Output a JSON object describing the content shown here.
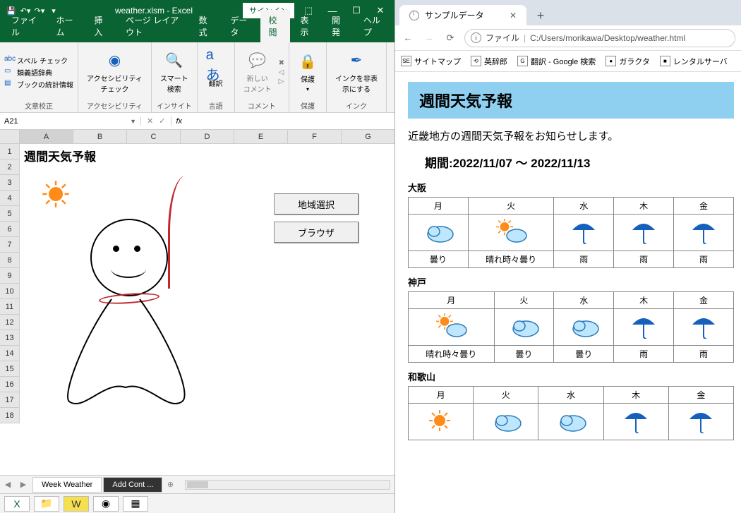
{
  "excel": {
    "filename": "weather.xlsm - Excel",
    "signin": "サインイン",
    "tabs": [
      "ファイル",
      "ホーム",
      "挿入",
      "ページ レイアウト",
      "数式",
      "データ",
      "校閲",
      "表示",
      "開発",
      "ヘルプ"
    ],
    "active_tab": "校閲",
    "ribbon": {
      "proofing": {
        "title": "文章校正",
        "spell": "スペル チェック",
        "thes": "類義語辞典",
        "stats": "ブックの統計情報"
      },
      "acc": {
        "title": "アクセシビリティ",
        "btn": "アクセシビリティ\nチェック"
      },
      "insights": {
        "title": "インサイト",
        "btn": "スマート\n検索"
      },
      "lang": {
        "title": "言語",
        "btn": "翻訳"
      },
      "comments": {
        "title": "コメント",
        "btn": "新しい\nコメント"
      },
      "protect": {
        "title": "保護",
        "btn": "保護"
      },
      "ink": {
        "title": "インク",
        "btn": "インクを非表\n示にする"
      }
    },
    "namebox": "A21",
    "cols": [
      "A",
      "B",
      "C",
      "D",
      "E",
      "F",
      "G"
    ],
    "rows": [
      "1",
      "2",
      "3",
      "4",
      "5",
      "6",
      "7",
      "8",
      "9",
      "10",
      "11",
      "12",
      "13",
      "14",
      "15",
      "16",
      "17",
      "18"
    ],
    "sheet_title": "週間天気予報",
    "btn_region": "地域選択",
    "btn_browser": "ブラウザ",
    "sheet_tabs": {
      "a": "Week Weather",
      "b": "Add Cont ..."
    }
  },
  "browser": {
    "tab_title": "サンプルデータ",
    "file_label": "ファイル",
    "url": "C:/Users/morikawa/Desktop/weather.html",
    "bookmarks": [
      {
        "ico": "SE",
        "label": "サイトマップ"
      },
      {
        "ico": "⟲",
        "label": "英辞郎"
      },
      {
        "ico": "G",
        "label": "翻訳 - Google 検索"
      },
      {
        "ico": "●",
        "label": "ガラクタ"
      },
      {
        "ico": "■",
        "label": "レンタルサーバ"
      }
    ],
    "page_title": "週間天気予報",
    "desc": "近畿地方の週間天気予報をお知らせします。",
    "period": "期間:2022/11/07 ～ 2022/11/13",
    "days": [
      "月",
      "火",
      "水",
      "木",
      "金"
    ],
    "cities": [
      {
        "name": "大阪",
        "icons": [
          "cloud",
          "suncloud",
          "umb",
          "umb",
          "umb"
        ],
        "txt": [
          "曇り",
          "晴れ時々曇り",
          "雨",
          "雨",
          "雨"
        ]
      },
      {
        "name": "神戸",
        "icons": [
          "suncloud",
          "cloud",
          "cloud",
          "umb",
          "umb"
        ],
        "txt": [
          "晴れ時々曇り",
          "曇り",
          "曇り",
          "雨",
          "雨"
        ]
      },
      {
        "name": "和歌山",
        "icons": [
          "sun",
          "cloud",
          "cloud",
          "umb",
          "umb"
        ],
        "txt": [
          "",
          "",
          "",
          "",
          ""
        ]
      }
    ]
  }
}
